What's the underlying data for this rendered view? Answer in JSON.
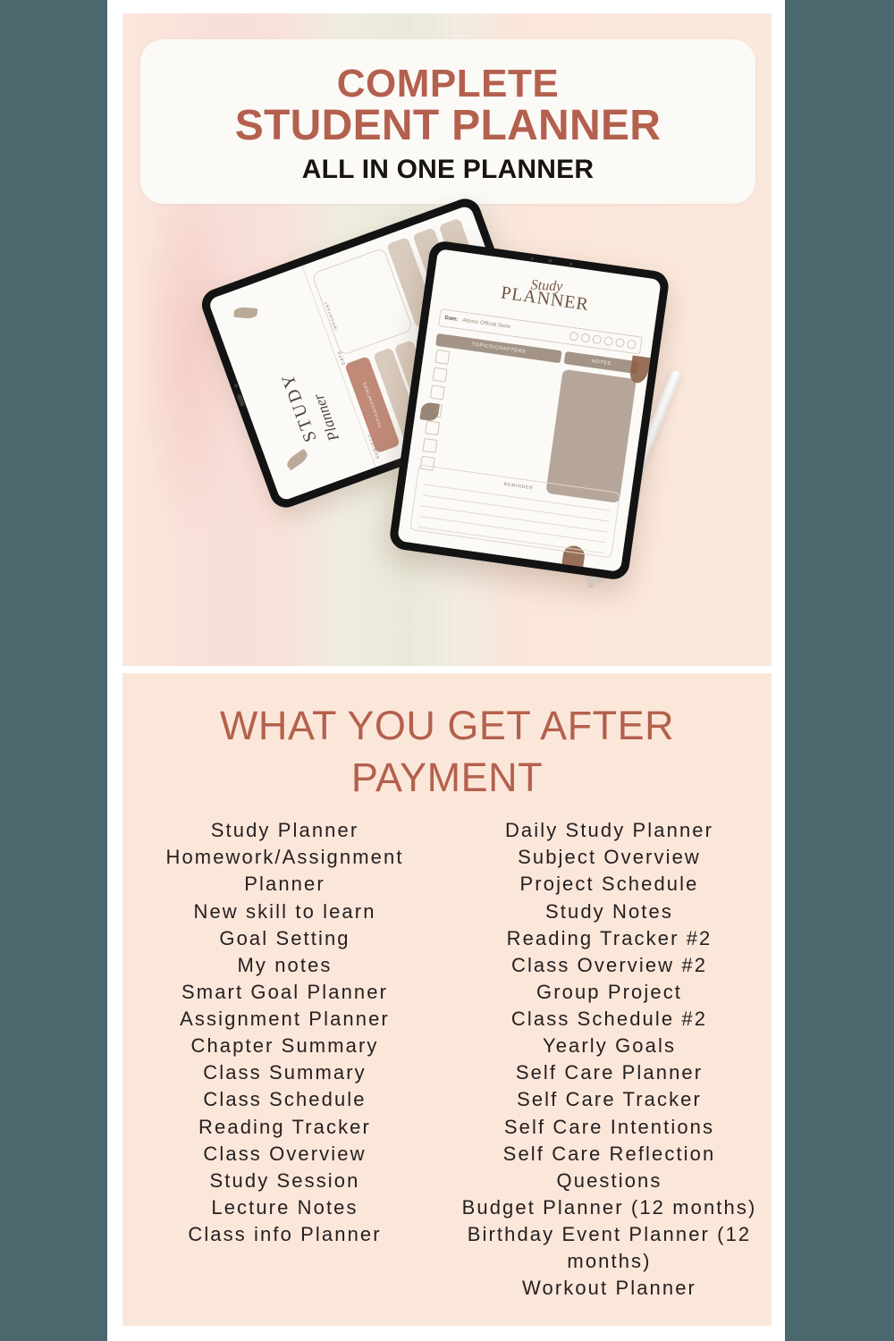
{
  "page": {
    "background_color": "#4b686f",
    "panel_color": "#fbe7d9",
    "accent_color": "#b4604e",
    "text_color": "#242021"
  },
  "hero": {
    "title_line1": "COMPLETE",
    "title_line2": "STUDENT PLANNER",
    "subtitle": "ALL IN ONE PLANNER",
    "back_tablet": {
      "brand_top": "STUDY",
      "brand_script": "Planner",
      "label_subject": "SUBJECT",
      "label_date": "DATE",
      "label_important": "IMPORTANT",
      "label_topics": "TOPICS/CHAPTERS"
    },
    "front_tablet": {
      "title_script": "Study",
      "title_main": "PLANNER",
      "date_label": "Date:",
      "date_value": "Atomic Official Store",
      "topics_header": "TOPICS/CHAPTERS",
      "notes_header": "NOTES",
      "reminder_header": "REMINDER"
    },
    "stylus": "apple-pencil"
  },
  "list_section": {
    "heading_line1": "WHAT YOU GET AFTER",
    "heading_line2": "PAYMENT",
    "left_column": [
      "Study Planner",
      "Homework/Assignment Planner",
      "New skill to learn",
      "Goal Setting",
      "My notes",
      "Smart Goal Planner",
      "Assignment Planner",
      "Chapter Summary",
      "Class Summary",
      "Class Schedule",
      "Reading Tracker",
      "Class Overview",
      "Study Session",
      "Lecture Notes",
      "Class info Planner"
    ],
    "right_column": [
      "Daily Study Planner",
      "Subject Overview",
      "Project Schedule",
      "Study Notes",
      "Reading Tracker #2",
      "Class Overview #2",
      "Group Project",
      "Class Schedule #2",
      "Yearly Goals",
      "Self Care Planner",
      "Self Care Tracker",
      "Self Care Intentions",
      "Self Care Reflection Questions",
      "Budget Planner (12 months)",
      "Birthday Event Planner (12 months)",
      "Workout Planner"
    ]
  }
}
